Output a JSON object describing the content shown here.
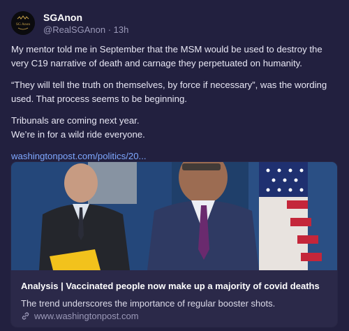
{
  "author": {
    "display_name": "SGAnon",
    "handle": "@RealSGAnon",
    "time": "13h",
    "avatar_text": "SG Anon"
  },
  "post": {
    "paragraphs": [
      "My mentor told me in September that the MSM would be used to destroy the very C19 narrative of death and carnage they perpetuated on humanity.",
      "“They will tell the truth on themselves, by force if necessary”, was the wording used. That process seems to be beginning.",
      "Tribunals are coming next year."
    ],
    "line_after_tribunals": "We’re in for a wild ride everyone.",
    "link_text": "washingtonpost.com/politics/20..."
  },
  "card": {
    "title": "Analysis | Vaccinated people now make up a majority of covid deaths",
    "description": "The trend underscores the importance of regular booster shots.",
    "domain": "www.washingtonpost.com"
  },
  "colors": {
    "background": "#22203f",
    "card_background": "#2b2949",
    "link": "#7fa8ff",
    "muted": "#9b99b8"
  },
  "icons": [
    "link-icon"
  ]
}
